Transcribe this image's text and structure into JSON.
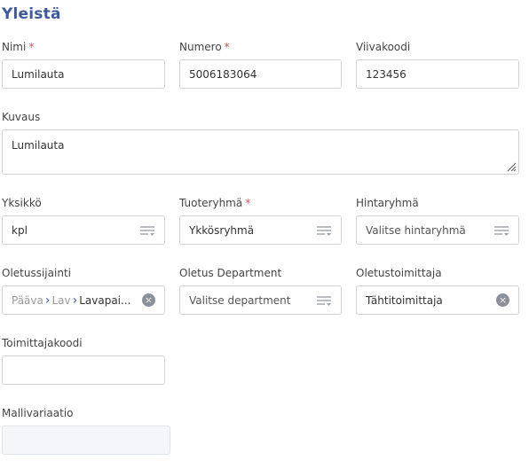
{
  "section": {
    "title": "Yleistä"
  },
  "fields": {
    "nimi": {
      "label": "Nimi",
      "required": "*",
      "value": "Lumilauta"
    },
    "numero": {
      "label": "Numero",
      "required": "*",
      "value": "5006183064"
    },
    "viivakoodi": {
      "label": "Viivakoodi",
      "value": "123456"
    },
    "kuvaus": {
      "label": "Kuvaus",
      "value": "Lumilauta"
    },
    "yksikko": {
      "label": "Yksikkö",
      "value": "kpl",
      "icon": "list-icon"
    },
    "tuoteryhma": {
      "label": "Tuoteryhmä",
      "required": "*",
      "value": "Ykkösryhmä",
      "icon": "list-icon"
    },
    "hintaryhma": {
      "label": "Hintaryhmä",
      "placeholder": "Valitse hintaryhmä",
      "icon": "list-icon"
    },
    "oletussijainti": {
      "label": "Oletussijainti",
      "crumbs": [
        "Pääva",
        "Lav",
        "Lavapai..."
      ],
      "icon": "clear-icon"
    },
    "department": {
      "label": "Oletus Department",
      "placeholder": "Valitse department",
      "icon": "list-icon"
    },
    "oletustoimittaja": {
      "label": "Oletustoimittaja",
      "value": "Tähtitoimittaja",
      "icon": "clear-icon"
    },
    "toimittajakoodi": {
      "label": "Toimittajakoodi",
      "value": ""
    },
    "mallivariaatio": {
      "label": "Mallivariaatio",
      "value": ""
    }
  },
  "colors": {
    "title": "#3d5a9e",
    "required": "#d9534f",
    "border": "#cfd3d8",
    "disabled_bg": "#f3f6fa"
  }
}
